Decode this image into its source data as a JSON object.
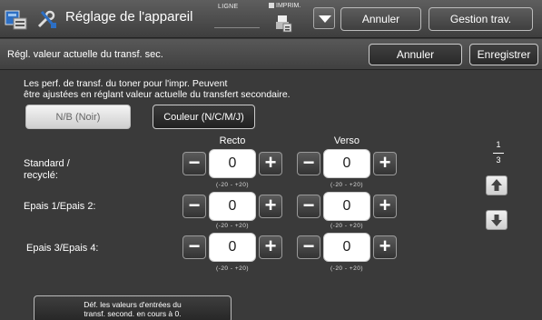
{
  "topbar": {
    "title": "Réglage de l'appareil",
    "ligne_label": "LIGNE",
    "imprim_label": "IMPRIM.",
    "cancel_label": "Annuler",
    "job_status_label": "Gestion trav."
  },
  "subbar": {
    "title": "Régl. valeur actuelle du transf. sec.",
    "cancel_label": "Annuler",
    "save_label": "Enregistrer"
  },
  "description": {
    "line1": "Les perf. de transf. du toner pour l'impr. Peuvent",
    "line2": "être ajustées en réglant valeur actuelle du transfert secondaire."
  },
  "modes": {
    "bw_label": "N/B (Noir)",
    "color_label": "Couleur (N/C/M/J)",
    "selected": "N/B (Noir)"
  },
  "columns": {
    "front": "Recto",
    "back": "Verso"
  },
  "rows": [
    {
      "label_line1": "Standard /",
      "label_line2": "recyclé:",
      "front": {
        "value": "0",
        "range": "(-20 - +20)"
      },
      "back": {
        "value": "0",
        "range": "(-20 - +20)"
      }
    },
    {
      "label_line1": "Epais 1/Epais 2:",
      "label_line2": "",
      "front": {
        "value": "0",
        "range": "(-20 - +20)"
      },
      "back": {
        "value": "0",
        "range": "(-20 - +20)"
      }
    },
    {
      "label_line1": "Epais 3/Epais 4:",
      "label_line2": "",
      "front": {
        "value": "0",
        "range": "(-20 - +20)"
      },
      "back": {
        "value": "0",
        "range": "(-20 - +20)"
      }
    }
  ],
  "stepper": {
    "minus": "−",
    "plus": "+"
  },
  "pager": {
    "current": "1",
    "total": "3"
  },
  "reset": {
    "line1": "Déf. les valeurs d'entrées du",
    "line2": "transf. second. en cours à 0."
  },
  "icons": {
    "app": "machine-settings-icon",
    "tool": "wrench-screwdriver-icon",
    "printer": "printer-icon",
    "dropdown": "triangle-down-icon",
    "page_up": "arrow-up-icon",
    "page_down": "arrow-down-icon"
  }
}
